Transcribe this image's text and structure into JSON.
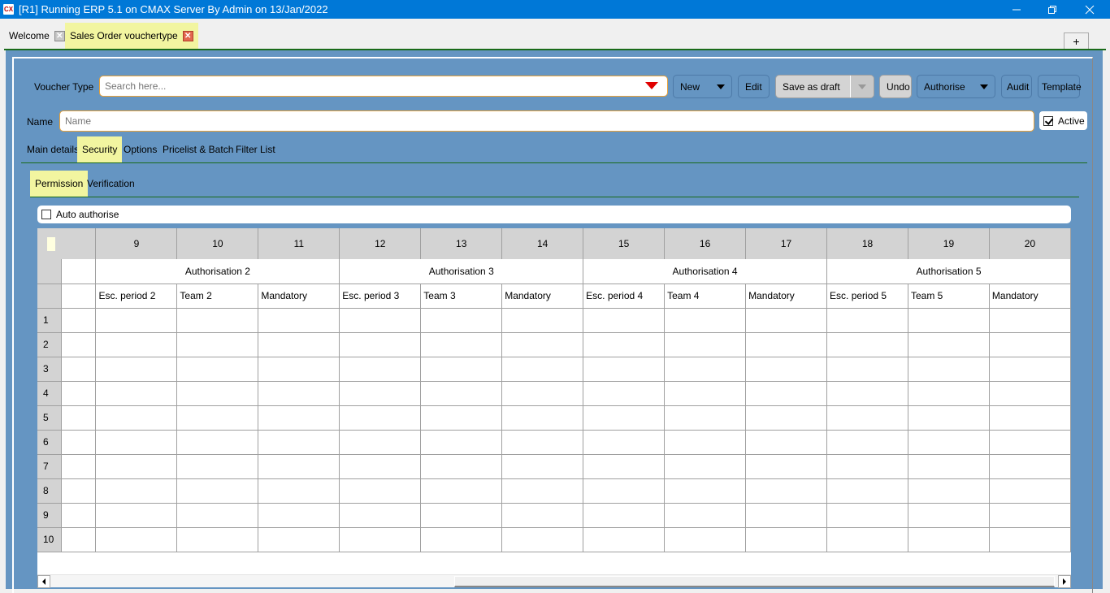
{
  "window": {
    "app_icon": "CX",
    "title": "[R1] Running ERP 5.1 on CMAX Server By Admin on 13/Jan/2022",
    "controls": [
      "minimize-icon",
      "restore-icon",
      "close-icon"
    ]
  },
  "doc_tabs": [
    {
      "label": "Welcome",
      "active": false
    },
    {
      "label": "Sales Order vouchertype",
      "active": true
    }
  ],
  "add_tab_label": "+",
  "toolbar": {
    "voucher_type_label": "Voucher Type",
    "search_placeholder": "Search here...",
    "new_label": "New",
    "edit_label": "Edit",
    "save_draft_label": "Save as draft",
    "undo_label": "Undo",
    "authorise_label": "Authorise",
    "audit_label": "Audit",
    "template_label": "Template",
    "accent_color": "#e00000"
  },
  "name_row": {
    "label": "Name",
    "placeholder": "Name",
    "active_label": "Active",
    "active_checked": true
  },
  "section_tabs": [
    {
      "label": "Main details",
      "active": false
    },
    {
      "label": "Security",
      "active": true
    },
    {
      "label": "Options",
      "active": false
    },
    {
      "label": "Pricelist & Batch",
      "active": false
    },
    {
      "label": "Filter List",
      "active": false
    }
  ],
  "sub_tabs": [
    {
      "label": "Permission",
      "active": true
    },
    {
      "label": "Verification",
      "active": false
    }
  ],
  "auto_authorise": {
    "label": "Auto authorise",
    "checked": false
  },
  "grid": {
    "column_numbers": [
      "9",
      "10",
      "11",
      "12",
      "13",
      "14",
      "15",
      "16",
      "17",
      "18",
      "19",
      "20"
    ],
    "groups": [
      "Authorisation 2",
      "Authorisation 3",
      "Authorisation 4",
      "Authorisation 5"
    ],
    "columns": [
      "Esc. period 2",
      "Team 2",
      "Mandatory",
      "Esc. period 3",
      "Team 3",
      "Mandatory",
      "Esc. period 4",
      "Team 4",
      "Mandatory",
      "Esc. period 5",
      "Team 5",
      "Mandatory"
    ],
    "row_numbers": [
      "1",
      "2",
      "3",
      "4",
      "5",
      "6",
      "7",
      "8",
      "9",
      "10"
    ]
  },
  "colors": {
    "panel_bg": "#6595c2",
    "active_tab_bg": "#f2f5a0",
    "titlebar_bg": "#0078d7",
    "divider_green": "#1a6b1a",
    "input_border": "#e8a23a"
  }
}
